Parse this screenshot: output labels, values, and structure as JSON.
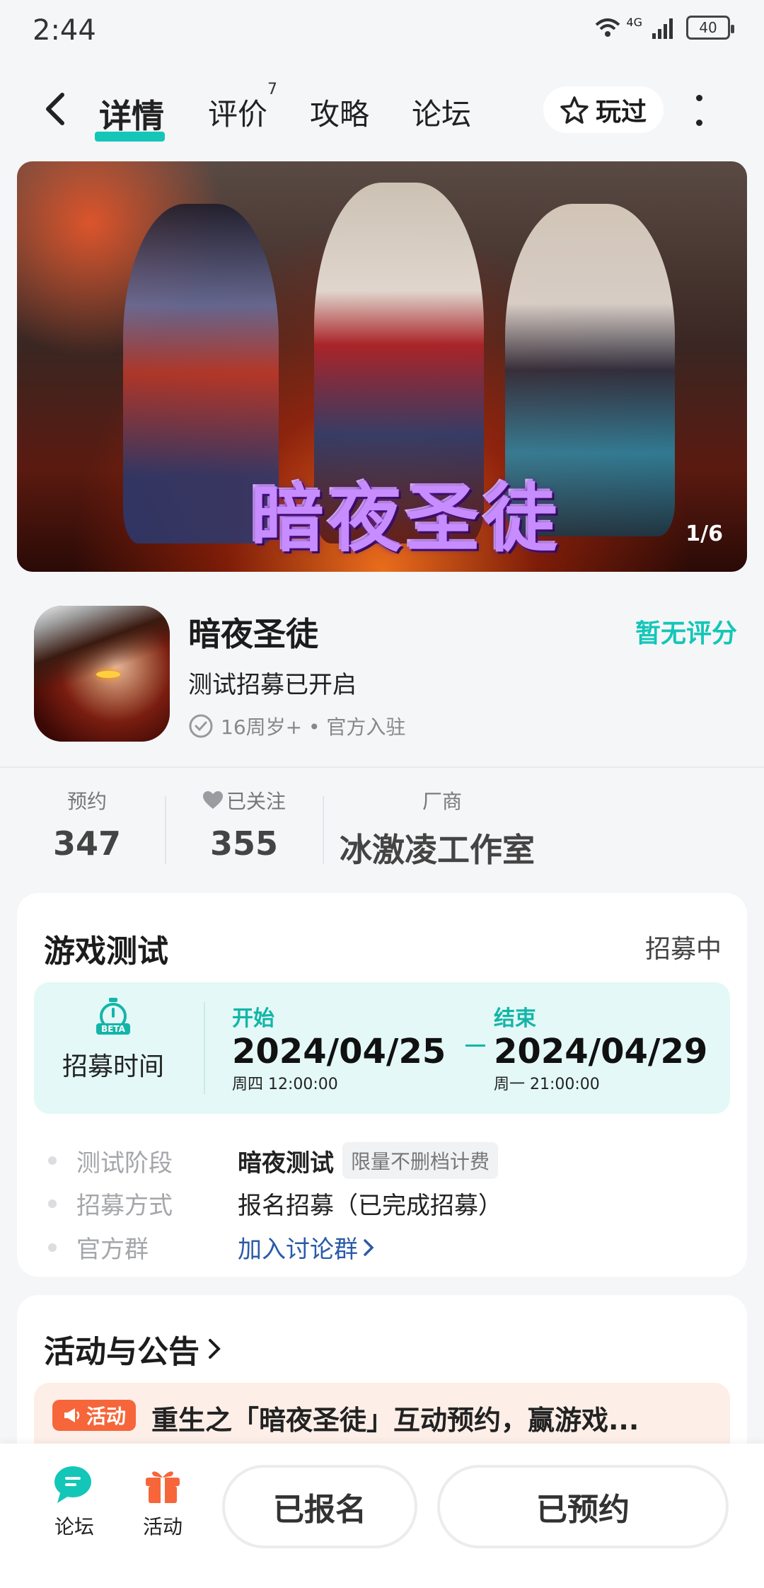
{
  "status_bar": {
    "time": "2:44",
    "network": "4G",
    "battery": "40"
  },
  "nav": {
    "tabs": [
      {
        "label": "详情",
        "active": true
      },
      {
        "label": "评价",
        "badge": "7"
      },
      {
        "label": "攻略"
      },
      {
        "label": "论坛"
      }
    ],
    "played_label": "玩过"
  },
  "hero": {
    "title_art": "暗夜圣徒",
    "counter": "1/6"
  },
  "game": {
    "name": "暗夜圣徒",
    "rating_text": "暂无评分",
    "subtitle": "测试招募已开启",
    "tags": "16周岁+ • 官方入驻"
  },
  "stats": {
    "reserve_label": "预约",
    "reserve_value": "347",
    "follow_label": "已关注",
    "follow_value": "355",
    "vendor_label": "厂商",
    "vendor_value": "冰激凌工作室"
  },
  "test_card": {
    "title": "游戏测试",
    "status": "招募中",
    "icon_text": "BETA",
    "time_label": "招募时间",
    "start_head": "开始",
    "start_date": "2024/04/25",
    "start_time": "周四  12:00:00",
    "end_head": "结束",
    "end_date": "2024/04/29",
    "end_time": "周一  21:00:00",
    "rows": [
      {
        "label": "测试阶段",
        "value": "暗夜测试",
        "pill": "限量不删档计费"
      },
      {
        "label": "招募方式",
        "value": "报名招募（已完成招募）"
      },
      {
        "label": "官方群",
        "value": "加入讨论群"
      }
    ]
  },
  "activity_card": {
    "title": "活动与公告",
    "tag": "活动",
    "notice": "重生之「暗夜圣徒」互动预约，赢游戏..."
  },
  "bottom": {
    "forum_label": "论坛",
    "activity_label": "活动",
    "signup_label": "已报名",
    "reserved_label": "已预约"
  },
  "colors": {
    "accent": "#14c6b8",
    "activity": "#f6663a",
    "link": "#2b5aa8"
  }
}
